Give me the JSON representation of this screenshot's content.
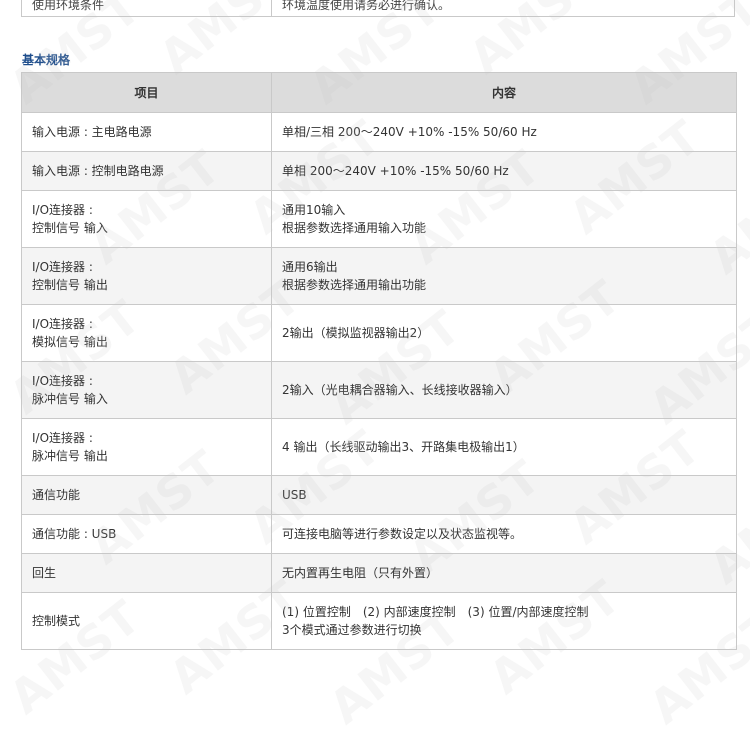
{
  "top_fragment": {
    "left": "使用环境条件",
    "right": "环境温度使用请务必进行确认。"
  },
  "section": {
    "title": "基本规格"
  },
  "table": {
    "headers": [
      "项目",
      "内容"
    ],
    "rows": [
      {
        "item": [
          "输入电源 : 主电路电源"
        ],
        "content": [
          "单相/三相 200～240V +10% -15% 50/60 Hz"
        ]
      },
      {
        "item": [
          "输入电源 : 控制电路电源"
        ],
        "content": [
          "单相 200～240V +10% -15% 50/60 Hz"
        ]
      },
      {
        "item": [
          "I/O连接器 :",
          "控制信号 输入"
        ],
        "content": [
          "通用10输入",
          "根据参数选择通用输入功能"
        ]
      },
      {
        "item": [
          "I/O连接器 :",
          "控制信号 输出"
        ],
        "content": [
          "通用6输出",
          "根据参数选择通用输出功能"
        ]
      },
      {
        "item": [
          "I/O连接器 :",
          "模拟信号 输出"
        ],
        "content": [
          "2输出（模拟监视器输出2）"
        ]
      },
      {
        "item": [
          "I/O连接器 :",
          "脉冲信号 输入"
        ],
        "content": [
          "2输入（光电耦合器输入、长线接收器输入）"
        ]
      },
      {
        "item": [
          "I/O连接器 :",
          "脉冲信号 输出"
        ],
        "content": [
          "4 输出（长线驱动输出3、开路集电极输出1）"
        ]
      },
      {
        "item": [
          "通信功能"
        ],
        "content": [
          "USB"
        ]
      },
      {
        "item": [
          "通信功能 : USB"
        ],
        "content": [
          "可连接电脑等进行参数设定以及状态监视等。"
        ]
      },
      {
        "item": [
          "回生"
        ],
        "content": [
          "无内置再生电阻（只有外置）"
        ]
      },
      {
        "item": [
          "控制模式"
        ],
        "content": [
          "(1) 位置控制　(2) 内部速度控制　(3) 位置/内部速度控制",
          "3个模式通过参数进行切换"
        ]
      }
    ]
  },
  "watermark": {
    "text": "AMST"
  }
}
